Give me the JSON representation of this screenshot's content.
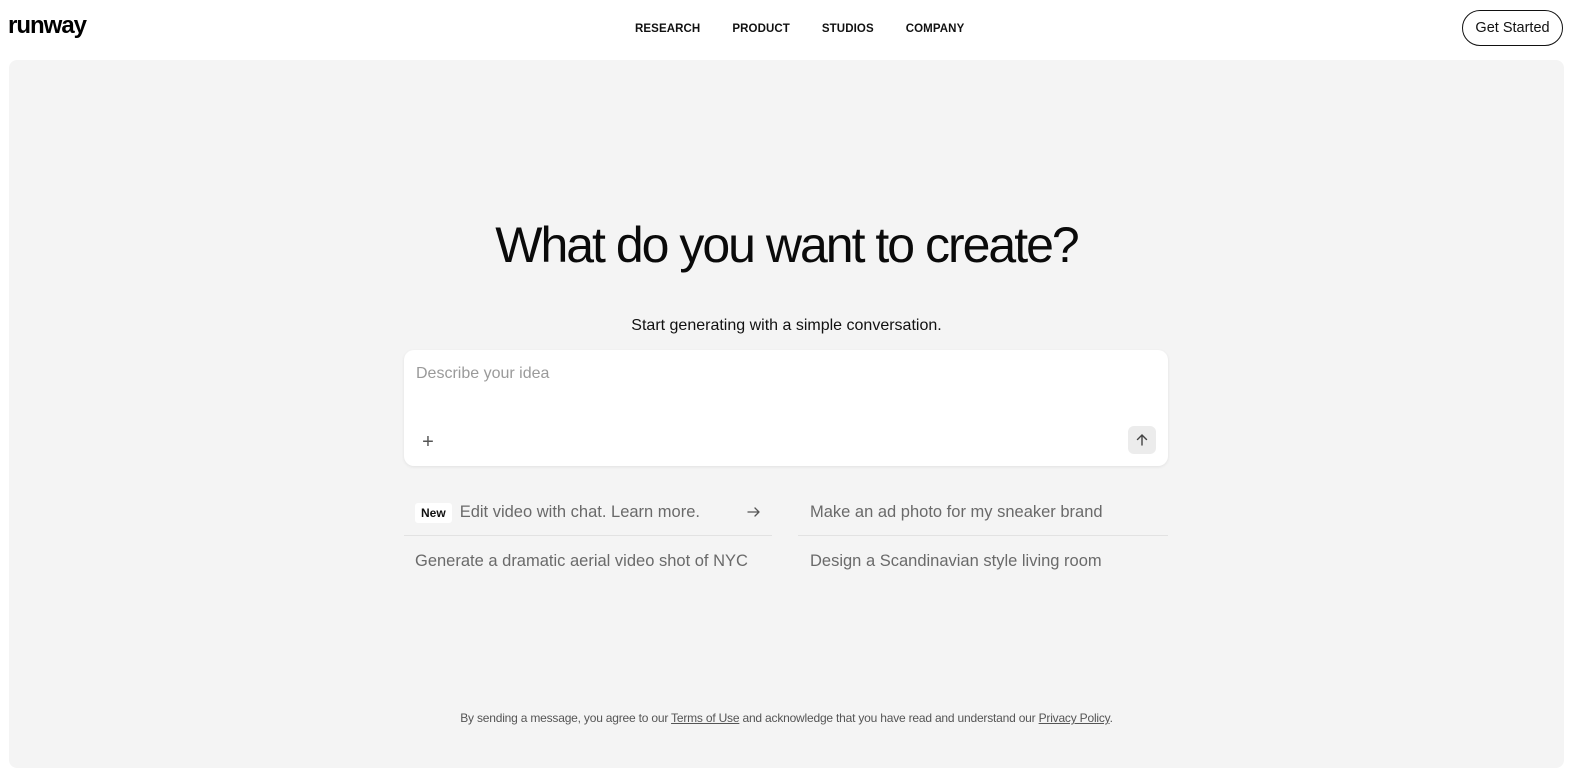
{
  "header": {
    "logo": "runway",
    "nav": [
      "RESEARCH",
      "PRODUCT",
      "STUDIOS",
      "COMPANY"
    ],
    "cta": "Get Started"
  },
  "hero": {
    "title": "What do you want to create?",
    "subtitle": "Start generating with a simple conversation."
  },
  "prompt": {
    "placeholder": "Describe your idea",
    "value": "",
    "add_icon": "plus-icon",
    "send_icon": "arrow-up-icon"
  },
  "suggestions": {
    "new_badge": "New",
    "featured": "Edit video with chat. Learn more.",
    "featured_icon": "arrow-right-icon",
    "item_2": "Make an ad photo for my sneaker brand",
    "item_3": "Generate a dramatic aerial video shot of NYC",
    "item_4": "Design a Scandinavian style living room"
  },
  "legal": {
    "prefix": "By sending a message, you agree to our",
    "terms": "Terms of Use",
    "middle": "and acknowledge that you have read and understand our",
    "privacy": "Privacy Policy",
    "suffix": "."
  }
}
